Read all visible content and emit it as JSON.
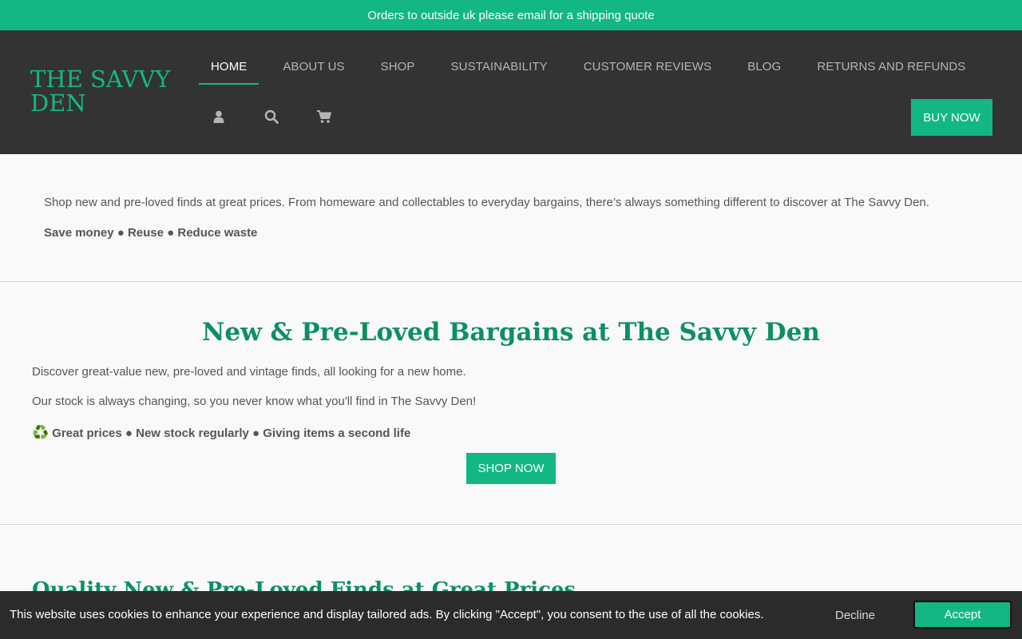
{
  "topbar": {
    "text": "Orders to outside uk please email for a shipping quote"
  },
  "header": {
    "logo": "THE SAVVY DEN",
    "nav": [
      {
        "label": "HOME",
        "active": true
      },
      {
        "label": "ABOUT US"
      },
      {
        "label": "SHOP"
      },
      {
        "label": "SUSTAINABILITY"
      },
      {
        "label": "CUSTOMER REVIEWS"
      },
      {
        "label": "BLOG"
      },
      {
        "label": "RETURNS AND REFUNDS"
      }
    ],
    "icons": [
      "user-icon",
      "search-icon",
      "cart-icon"
    ],
    "buy_label": "BUY NOW"
  },
  "intro": {
    "text": "Shop new and pre-loved finds at great prices. From homeware and collectables to everyday bargains, there’s always something different to discover at The Savvy Den.",
    "bold": "Save money ● Reuse ● Reduce waste"
  },
  "section2": {
    "title": "New & Pre-Loved Bargains at The Savvy Den",
    "p1": "Discover great-value new, pre-loved and vintage finds, all looking for a new home.",
    "p2": "Our stock is always changing, so you never know what you'll find in The Savvy Den!",
    "bold_icon": "♻️",
    "bold": "Great prices ● New stock regularly ● Giving items a second life",
    "shop_label": "SHOP NOW"
  },
  "section3": {
    "title": "Quality New & Pre-Loved Finds at Great Prices"
  },
  "cookie": {
    "text": "This website uses cookies to enhance your experience and display tailored ads. By clicking \"Accept\", you consent to the use of all the cookies.",
    "decline": "Decline",
    "accept": "Accept"
  },
  "colors": {
    "accent": "#13b784",
    "header_bg": "#333333",
    "title_green": "#0d8f63",
    "cookie_bg": "#2b2b2b"
  }
}
